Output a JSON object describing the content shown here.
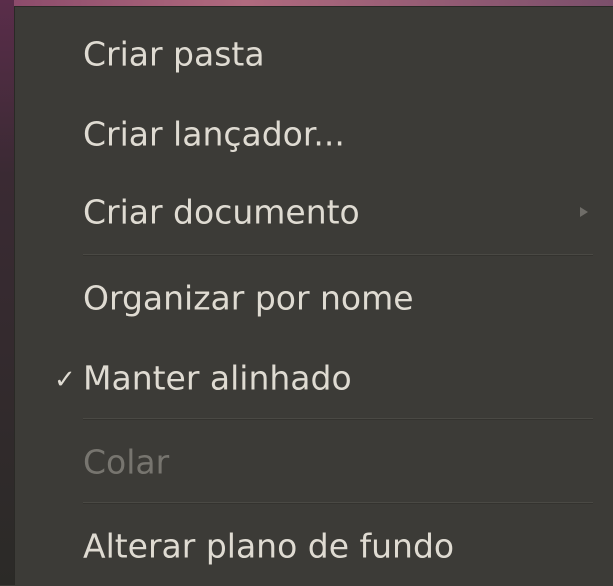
{
  "menu": {
    "items": [
      {
        "label": "Criar pasta"
      },
      {
        "label": "Criar lançador..."
      },
      {
        "label": "Criar documento"
      },
      {
        "label": "Organizar por nome"
      },
      {
        "label": "Manter alinhado",
        "check": "✓"
      },
      {
        "label": "Colar"
      },
      {
        "label": "Alterar plano de fundo"
      }
    ]
  },
  "colors": {
    "menu_bg": "#3c3b37",
    "text": "#dfdbd2",
    "disabled_text": "#77756f",
    "separator": "#4a4944"
  }
}
